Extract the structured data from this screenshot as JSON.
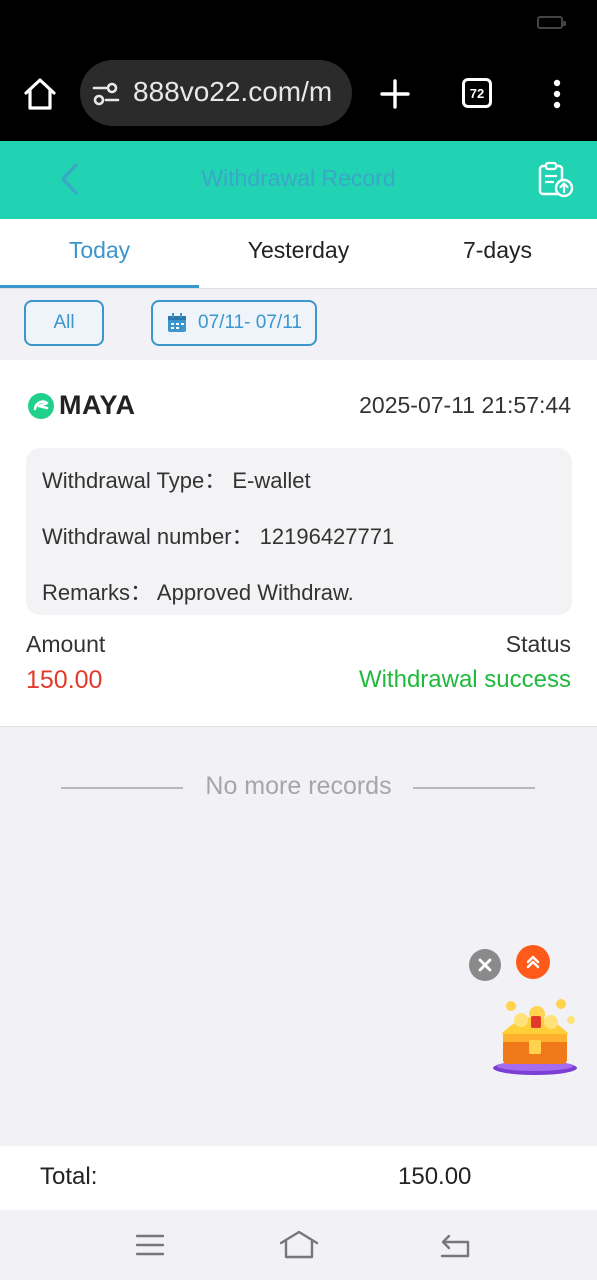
{
  "browser": {
    "url": "888vo22.com/m",
    "tab_count": "72"
  },
  "header": {
    "title": "Withdrawal Record"
  },
  "tabs": [
    {
      "label": "Today"
    },
    {
      "label": "Yesterday"
    },
    {
      "label": "7-days"
    }
  ],
  "filters": {
    "type": "All",
    "date_range": "07/11- 07/11"
  },
  "record": {
    "provider": "MAYA",
    "datetime": "2025-07-11 21:57:44",
    "type_label": "Withdrawal Type：",
    "type_value": "E-wallet",
    "number_label": "Withdrawal number：",
    "number_value": "12196427771",
    "remarks_label": "Remarks：",
    "remarks_value": "Approved Withdraw.",
    "amount_label": "Amount",
    "amount_value": "150.00",
    "status_label": "Status",
    "status_value": "Withdrawal success"
  },
  "list_end": "No more records",
  "footer": {
    "total_label": "Total:",
    "total_value": "150.00"
  },
  "colors": {
    "header_bg": "#22d3b3",
    "accent": "#3b96cc",
    "amount": "#e23a2a",
    "success": "#1fba3b"
  }
}
